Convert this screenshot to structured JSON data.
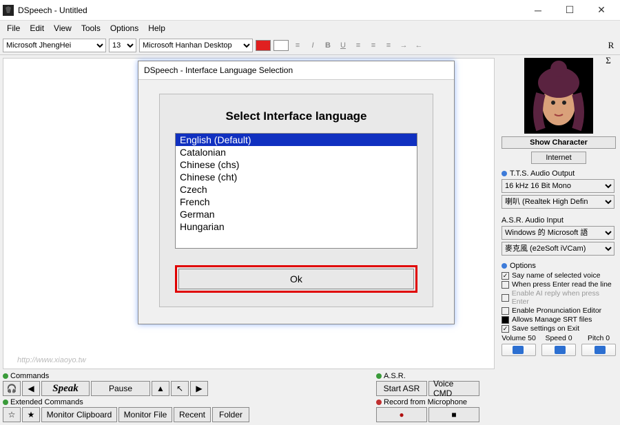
{
  "title": "DSpeech - Untitled",
  "menu": [
    "File",
    "Edit",
    "View",
    "Tools",
    "Options",
    "Help"
  ],
  "toolbar": {
    "font": "Microsoft JhengHei",
    "size": "13",
    "voice": "Microsoft Hanhan Desktop",
    "markR": "R",
    "markS": "Σ"
  },
  "sidebar": {
    "show_char": "Show Character",
    "internet": "Internet",
    "tts_label": "T.T.S. Audio Output",
    "tts_fmt": "16 kHz 16 Bit Mono",
    "tts_dev": "喇叭 (Realtek High Defin",
    "asr_label": "A.S.R. Audio Input",
    "asr_eng": "Windows 的 Microsoft 語",
    "asr_dev": "麥克風 (e2eSoft iVCam)",
    "opt_label": "Options",
    "opts": [
      {
        "label": "Say name of selected voice",
        "chk": true
      },
      {
        "label": "When press Enter read the line",
        "chk": false
      },
      {
        "label": "Enable AI reply when press Enter",
        "chk": false,
        "dim": true
      },
      {
        "label": "Enable Pronunciation Editor",
        "chk": false
      },
      {
        "label": "Allows Manage SRT files",
        "chk": true,
        "fill": true
      },
      {
        "label": "Save settings on Exit",
        "chk": true
      }
    ],
    "sliders": [
      {
        "label": "Volume 50",
        "pos": 15
      },
      {
        "label": "Speed 0",
        "pos": 18
      },
      {
        "label": "Pitch 0",
        "pos": 18
      }
    ]
  },
  "bottom": {
    "cmds": "Commands",
    "speak": "Speak",
    "pause": "Pause",
    "ext": "Extended Commands",
    "monclip": "Monitor Clipboard",
    "monfile": "Monitor File",
    "recent": "Recent",
    "folder": "Folder",
    "asr": "A.S.R.",
    "startasr": "Start ASR",
    "voicecmd": "Voice CMD",
    "rec": "Record from Microphone"
  },
  "modal": {
    "title": "DSpeech - Interface Language Selection",
    "heading": "Select Interface language",
    "langs": [
      "English (Default)",
      "Catalonian",
      "Chinese (chs)",
      "Chinese (cht)",
      "Czech",
      "French",
      "German",
      "Hungarian"
    ],
    "ok": "Ok"
  },
  "watermark": "http://www.xiaoyo.tw"
}
